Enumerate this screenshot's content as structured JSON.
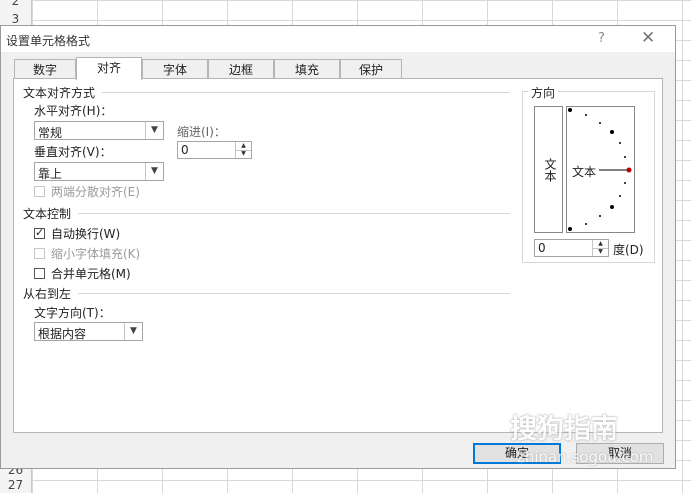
{
  "sheet": {
    "row_numbers": {
      "r2": "2",
      "r3": "3",
      "r26": "26",
      "r27": "27"
    }
  },
  "dialog": {
    "title": "设置单元格格式",
    "help": "?",
    "close": "✕"
  },
  "tabs": [
    "数字",
    "对齐",
    "字体",
    "边框",
    "填充",
    "保护"
  ],
  "alignment": {
    "section_text_alignment": "文本对齐方式",
    "horizontal_label": "水平对齐(H)：",
    "horizontal_value": "常规",
    "indent_label": "缩进(I)：",
    "indent_value": "0",
    "vertical_label": "垂直对齐(V)：",
    "vertical_value": "靠上",
    "distributed_label": "两端分散对齐(E)"
  },
  "text_control": {
    "section": "文本控制",
    "wrap_label": "自动换行(W)",
    "wrap_checked": "✓",
    "shrink_label": "缩小字体填充(K)",
    "merge_label": "合并单元格(M)"
  },
  "rtl": {
    "section": "从右到左",
    "direction_label": "文字方向(T)：",
    "direction_value": "根据内容"
  },
  "orientation": {
    "section": "方向",
    "vertical_text": "文本",
    "dial_text": "文本",
    "degree_value": "0",
    "degree_label": "度(D)",
    "accent_color": "#c00000"
  },
  "buttons": {
    "ok": "确定",
    "cancel": "取消"
  },
  "watermark": {
    "main": "搜狗指南",
    "url": "zhinan.sogou.com"
  }
}
